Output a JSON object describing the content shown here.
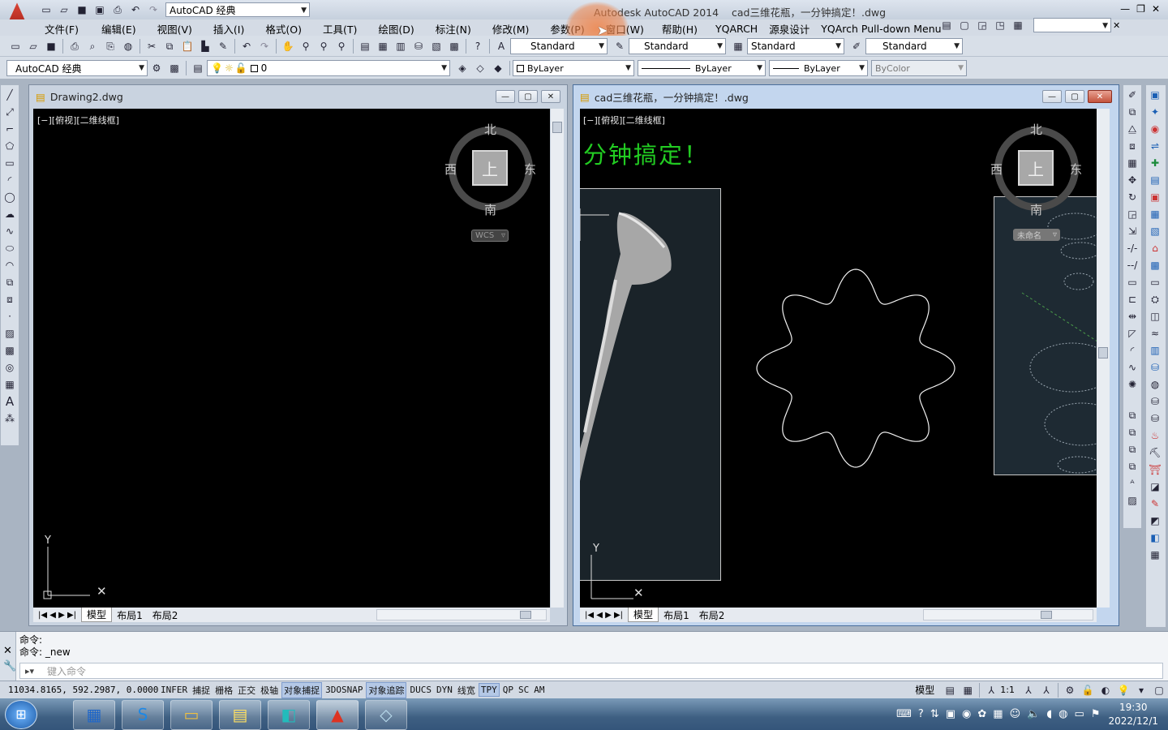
{
  "title": {
    "app": "Autodesk AutoCAD 2014",
    "doc": "cad三维花瓶，一分钟搞定！.dwg",
    "workspace": "AutoCAD 经典"
  },
  "menu": [
    "文件(F)",
    "编辑(E)",
    "视图(V)",
    "插入(I)",
    "格式(O)",
    "工具(T)",
    "绘图(D)",
    "标注(N)",
    "修改(M)",
    "参数(P)",
    "窗口(W)",
    "帮助(H)",
    "YQARCH",
    "源泉设计",
    "YQArch Pull-down Menu"
  ],
  "styles": {
    "text_style": "Standard",
    "dim_style": "Standard",
    "table_style": "Standard",
    "mleader_style": "Standard"
  },
  "layer": {
    "workspace": "AutoCAD 经典",
    "current": "0",
    "color": "ByLayer",
    "linetype": "ByLayer",
    "lineweight": "ByLayer",
    "plotstyle": "ByColor"
  },
  "left_window": {
    "title": "Drawing2.dwg",
    "viewport": "[−][俯视][二维线框]",
    "tabs": [
      "模型",
      "布局1",
      "布局2"
    ]
  },
  "right_window": {
    "title": "cad三维花瓶，一分钟搞定！.dwg",
    "viewport": "[−][俯视][二维线框]",
    "overlay_text": "分钟搞定！",
    "tabs": [
      "模型",
      "布局1",
      "布局2"
    ],
    "wcs_label": "未命名"
  },
  "viewcube": {
    "north": "北",
    "south": "南",
    "west": "西",
    "east": "东",
    "top": "上",
    "wcs": "WCS"
  },
  "command": {
    "history": [
      "命令:",
      "命令:  _new"
    ],
    "placeholder": "键入命令"
  },
  "status": {
    "coords": "11034.8165, 592.2987, 0.0000",
    "toggles": [
      {
        "label": "INFER",
        "on": false
      },
      {
        "label": "捕捉",
        "on": false
      },
      {
        "label": "栅格",
        "on": false
      },
      {
        "label": "正交",
        "on": false
      },
      {
        "label": "极轴",
        "on": false
      },
      {
        "label": "对象捕捉",
        "on": true
      },
      {
        "label": "3DOSNAP",
        "on": false
      },
      {
        "label": "对象追踪",
        "on": true
      },
      {
        "label": "DUCS",
        "on": false
      },
      {
        "label": "DYN",
        "on": false
      },
      {
        "label": "线宽",
        "on": false
      },
      {
        "label": "TPY",
        "on": true
      },
      {
        "label": "QP",
        "on": false
      },
      {
        "label": "SC",
        "on": false
      },
      {
        "label": "AM",
        "on": false
      }
    ],
    "model": "模型",
    "scale": "1:1"
  },
  "taskbar": {
    "time": "19:30",
    "date": "2022/12/1"
  },
  "colors": {
    "accent_green": "#22cc22",
    "canvas": "#000000",
    "highlight": "#f08a4b"
  }
}
